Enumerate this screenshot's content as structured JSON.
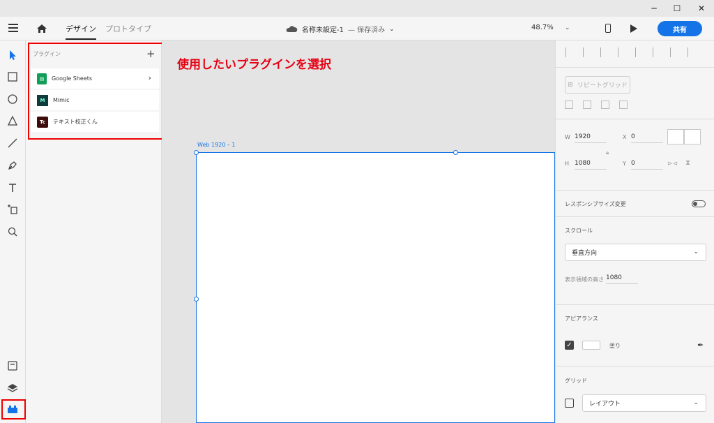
{
  "window": {
    "minimize": "─",
    "maximize": "☐",
    "close": "✕"
  },
  "header": {
    "tabs": [
      "デザイン",
      "プロトタイプ"
    ],
    "doc_title": "名称未設定-1",
    "doc_status": "— 保存済み",
    "zoom": "48.7%",
    "share_label": "共有"
  },
  "plugins": {
    "title": "プラグイン",
    "add": "+",
    "items": [
      {
        "label": "Google Sheets",
        "icon": "google-sheets-icon",
        "color": "#0f9d58",
        "icon_text": "▤",
        "arrow": "›"
      },
      {
        "label": "Mimic",
        "icon": "mimic-icon",
        "color": "#0e3b3b",
        "icon_text": "M"
      },
      {
        "label": "テキスト校正くん",
        "icon": "text-proofreading-icon",
        "color": "#3d0b0b",
        "icon_text": "Tc"
      }
    ]
  },
  "annotation": "使用したいプラグインを選択",
  "artboard": {
    "label": "Web 1920 – 1"
  },
  "properties": {
    "repeat_grid": "リピートグリッド",
    "w_label": "W",
    "w_value": "1920",
    "h_label": "H",
    "h_value": "1080",
    "x_label": "X",
    "x_value": "0",
    "y_label": "Y",
    "y_value": "0",
    "responsive_resize": "レスポンシブサイズ変更",
    "scroll_title": "スクロール",
    "scroll_value": "垂直方向",
    "viewport_height_label": "表示領域の高さ",
    "viewport_height_value": "1080",
    "appearance_title": "アピアランス",
    "fill_label": "塗り",
    "grid_title": "グリッド",
    "grid_value": "レイアウト"
  },
  "colors": {
    "accent": "#1473e6",
    "annotation_red": "#e60012"
  }
}
